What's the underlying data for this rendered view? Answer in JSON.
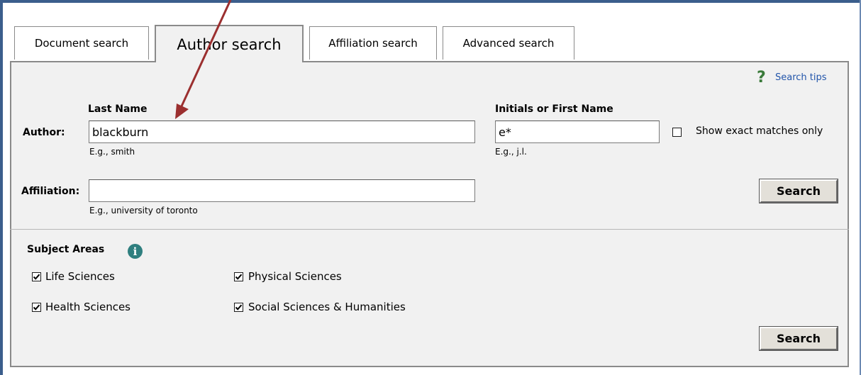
{
  "tabs": [
    {
      "label": "Document search"
    },
    {
      "label": "Author search"
    },
    {
      "label": "Affiliation search"
    },
    {
      "label": "Advanced search"
    }
  ],
  "search_tips": {
    "label": "Search tips",
    "icon": "question-mark-icon",
    "icon_char": "?"
  },
  "author": {
    "row_label": "Author:",
    "last_name_label": "Last Name",
    "last_name_value": "blackburn",
    "last_name_hint": "E.g., smith",
    "first_name_label": "Initials or First Name",
    "first_name_value": "e*",
    "first_name_hint": "E.g., j.l.",
    "exact_match_label": "Show exact matches only"
  },
  "affiliation": {
    "label": "Affiliation:",
    "value": "",
    "hint": "E.g., university of toronto"
  },
  "search_button_label": "Search",
  "subject_areas": {
    "title": "Subject Areas",
    "info_icon": "i",
    "items": [
      {
        "label": "Life Sciences",
        "checked": true
      },
      {
        "label": "Physical Sciences",
        "checked": true
      },
      {
        "label": "Health Sciences",
        "checked": true
      },
      {
        "label": "Social Sciences & Humanities",
        "checked": true
      }
    ]
  },
  "colors": {
    "arrow": "#9b2f2f",
    "link": "#2255aa",
    "help_icon": "#3a7a3a",
    "info_icon": "#2f7f7f"
  }
}
